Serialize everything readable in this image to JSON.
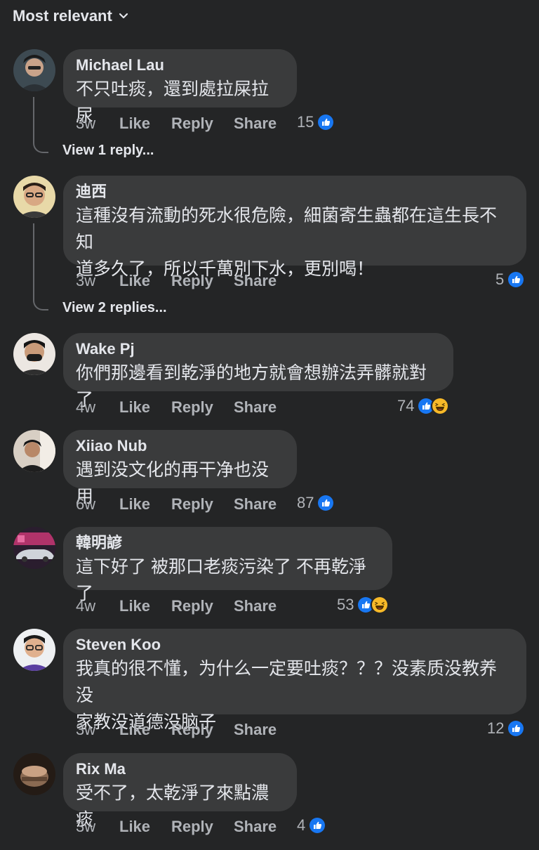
{
  "sort": {
    "label": "Most relevant",
    "icon": "chevron-down-icon"
  },
  "actions": {
    "like": "Like",
    "reply": "Reply",
    "share": "Share"
  },
  "comments": [
    {
      "author": "Michael Lau",
      "lines": [
        "不只吐痰，還到處拉屎拉尿"
      ],
      "time": "3w",
      "count": "15",
      "reactions": [
        "like"
      ],
      "replies": "View 1 reply..."
    },
    {
      "author": "迪西",
      "lines": [
        "這種沒有流動的死水很危險，細菌寄生蟲都在這生長不知",
        "道多久了，所以千萬別下水，更別喝！"
      ],
      "time": "3w",
      "count": "5",
      "reactions": [
        "like"
      ],
      "replies": "View 2 replies..."
    },
    {
      "author": "Wake Pj",
      "lines": [
        "你們那邊看到乾淨的地方就會想辦法弄髒就對了"
      ],
      "time": "4w",
      "count": "74",
      "reactions": [
        "like",
        "haha"
      ]
    },
    {
      "author": "Xiiao Nub",
      "lines": [
        "遇到没文化的再干净也没用"
      ],
      "time": "6w",
      "count": "87",
      "reactions": [
        "like"
      ]
    },
    {
      "author": "韓明諺",
      "lines": [
        "這下好了 被那口老痰污染了 不再乾淨了"
      ],
      "time": "4w",
      "count": "53",
      "reactions": [
        "like",
        "haha"
      ]
    },
    {
      "author": "Steven Koo",
      "lines": [
        "我真的很不懂，为什么一定要吐痰？？？没素质没教养没",
        "家教没道德没脑子"
      ],
      "time": "3w",
      "count": "12",
      "reactions": [
        "like"
      ]
    },
    {
      "author": "Rix Ma",
      "lines": [
        "受不了，太乾淨了來點濃痰"
      ],
      "time": "3w",
      "count": "4",
      "reactions": [
        "like"
      ]
    }
  ],
  "colors": {
    "background": "#242526",
    "bubble": "#3a3b3c",
    "like_blue": "#1877f2",
    "haha_yellow": "#f7b928",
    "muted": "#b0b3b8"
  }
}
